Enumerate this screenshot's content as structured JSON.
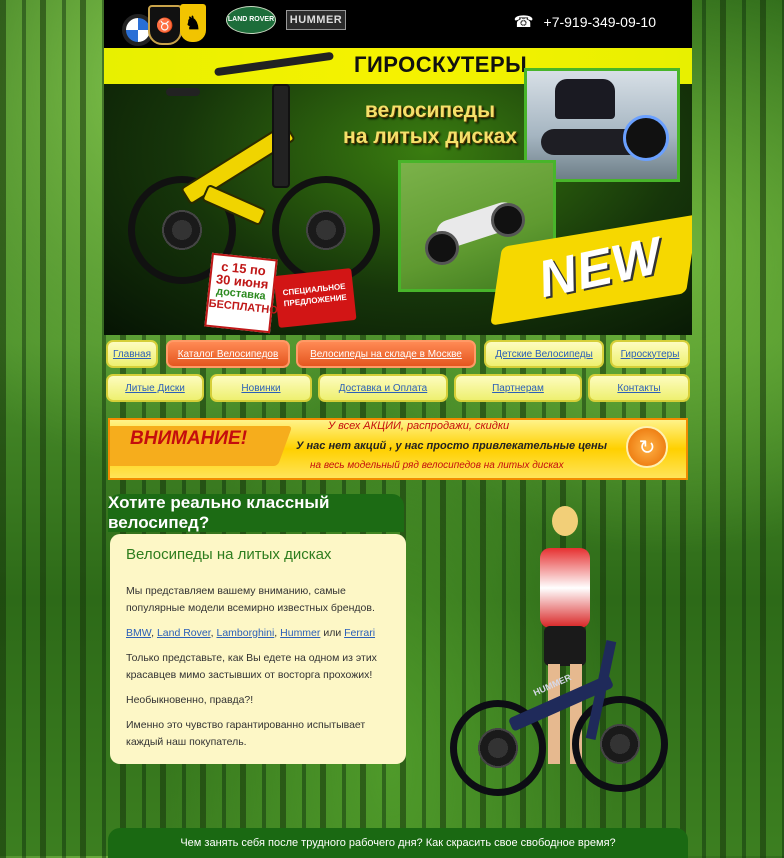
{
  "header": {
    "logos": [
      "bmw-logo",
      "lamborghini-logo",
      "ferrari-logo",
      "land-rover-logo",
      "hummer-logo"
    ],
    "landrover_text": "LAND ROVER",
    "hummer_text": "HUMMER",
    "phone_icon": "phone-icon",
    "phone": "+7-919-349-09-10",
    "gyro_title": "ГИРОСКУТЕРЫ",
    "bike_title_line1": "велосипеды",
    "bike_title_line2": "на литых дисках",
    "new_badge": "NEW",
    "promo_date": {
      "l1": "с 15 по",
      "l2": "30 июня",
      "l3": "доставка",
      "l4": "БЕСПЛАТНО"
    },
    "promo_special": {
      "l1": "СПЕЦИАЛЬНОЕ",
      "l2": "ПРЕДЛОЖЕНИЕ"
    }
  },
  "nav": {
    "row1": [
      "Главная",
      "Каталог Велосипедов",
      "Велосипеды на складе в Москве",
      "Детские Велосипеды",
      "Гироскутеры"
    ],
    "row2": [
      "Литые Диски",
      "Новинки",
      "Доставка и Оплата",
      "Партнерам",
      "Контакты"
    ]
  },
  "attention": {
    "title": "ВНИМАНИЕ!",
    "line1": "У всех АКЦИИ, распродажи, скидки",
    "line2": "У нас нет акций , у нас просто привлекательные цены",
    "line3": "на весь модельный ряд велосипедов на литых дисках",
    "icon": "refresh-icon"
  },
  "content": {
    "heading": "Хотите реально классный велосипед?",
    "title": "Велосипеды на литых дисках",
    "p1": "Мы представляем вашему вниманию, самые популярные модели всемирно известных брендов.",
    "brands": [
      "BMW",
      "Land Rover",
      "Lamborghini",
      "Hummer",
      "Ferrari"
    ],
    "brand_sep": ", ",
    "brand_or": " или ",
    "p3": "Только представьте, как Вы едете на одном из этих красавцев мимо застывших от восторга прохожих!",
    "p4": "Необыкновенно, правда?!",
    "p5": "Именно это чувство гарантированно испытывает каждый наш покупатель."
  },
  "photo_bike_label": "HUMMER",
  "footer_text": "Чем занять себя после трудного рабочего дня? Как скрасить свое свободное время?",
  "colors": {
    "accent_yellow": "#f6f200",
    "active_orange": "#e4561f",
    "green": "#1c6b14"
  }
}
